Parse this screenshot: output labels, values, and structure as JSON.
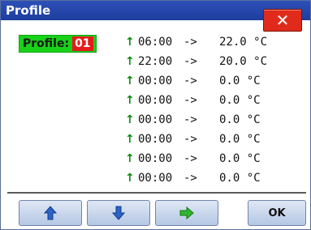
{
  "window": {
    "title": "Profile",
    "close_glyph": "✕"
  },
  "profile": {
    "label": "Profile:",
    "number": "01"
  },
  "rows": [
    {
      "time": "06:00",
      "sep": "->",
      "temp": "22.0 °C"
    },
    {
      "time": "22:00",
      "sep": "->",
      "temp": "20.0 °C"
    },
    {
      "time": "00:00",
      "sep": "->",
      "temp": "0.0 °C"
    },
    {
      "time": "00:00",
      "sep": "->",
      "temp": "0.0 °C"
    },
    {
      "time": "00:00",
      "sep": "->",
      "temp": "0.0 °C"
    },
    {
      "time": "00:00",
      "sep": "->",
      "temp": "0.0 °C"
    },
    {
      "time": "00:00",
      "sep": "->",
      "temp": "0.0 °C"
    },
    {
      "time": "00:00",
      "sep": "->",
      "temp": "0.0 °C"
    }
  ],
  "row_arrow": "↑",
  "buttons": {
    "ok_label": "OK"
  },
  "colors": {
    "titlebar": "#2d50b8",
    "profile_badge": "#18d118",
    "profile_number": "#e51b1b",
    "close": "#e02a1b",
    "arrow_up": "#0a8c0a"
  }
}
